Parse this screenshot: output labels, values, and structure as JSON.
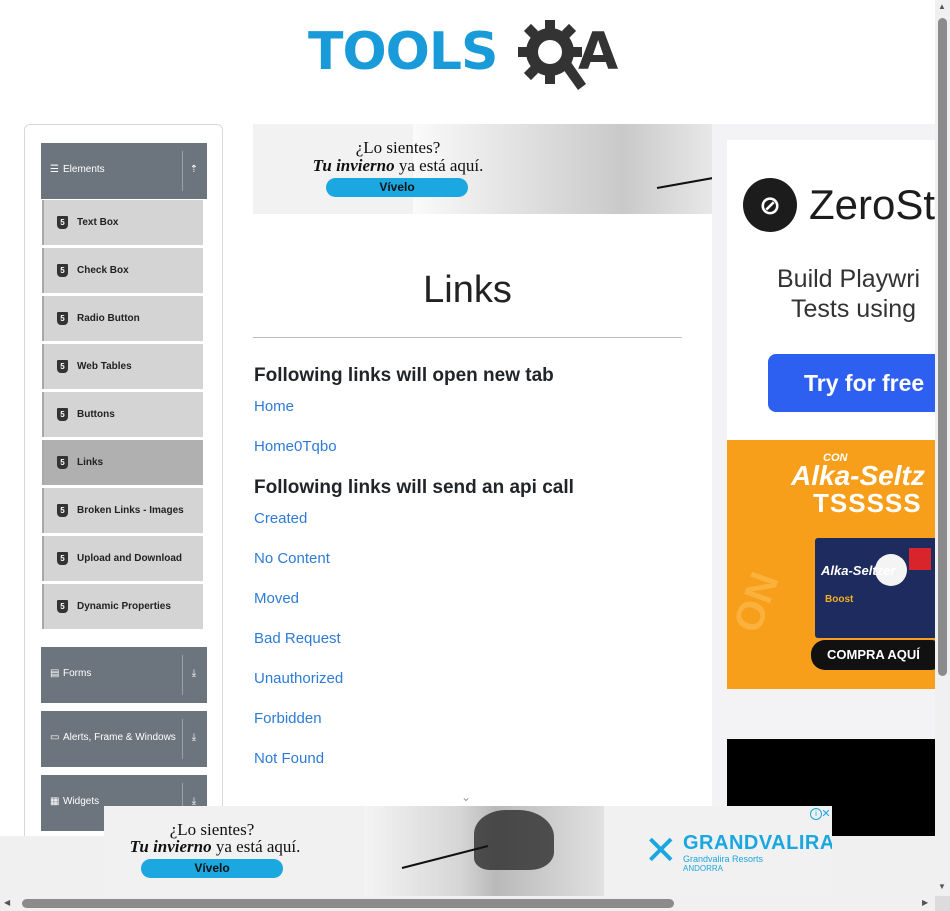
{
  "header": {
    "logo_tools": "TOOLS",
    "logo_q": "Q",
    "logo_a": "A"
  },
  "sidebar": {
    "groups": [
      {
        "label": "Elements",
        "icon": "hamburger-icon",
        "arrow": "up-arrow-icon"
      },
      {
        "label": "Forms",
        "icon": "doc-icon",
        "arrow": "down-arrow-icon"
      },
      {
        "label": "Alerts, Frame & Windows",
        "icon": "window-icon",
        "arrow": "down-arrow-icon"
      },
      {
        "label": "Widgets",
        "icon": "grid-icon",
        "arrow": "down-arrow-icon"
      }
    ],
    "items": [
      {
        "label": "Text Box"
      },
      {
        "label": "Check Box"
      },
      {
        "label": "Radio Button"
      },
      {
        "label": "Web Tables"
      },
      {
        "label": "Buttons"
      },
      {
        "label": "Links",
        "active": true
      },
      {
        "label": "Broken Links - Images"
      },
      {
        "label": "Upload and Download"
      },
      {
        "label": "Dynamic Properties"
      }
    ]
  },
  "ad_top": {
    "line1": "¿Lo sientes?",
    "line2_em": "Tu invierno",
    "line2_rest": " ya está aquí.",
    "button": "Vívelo"
  },
  "main": {
    "title": "Links",
    "section1": "Following links will open new tab",
    "links1": [
      "Home",
      "Home0Tqbo"
    ],
    "section2": "Following links will send an api call",
    "links2": [
      "Created",
      "No Content",
      "Moved",
      "Bad Request",
      "Unauthorized",
      "Forbidden",
      "Not Found"
    ]
  },
  "right_ad": {
    "brand": "ZeroSt",
    "tag1": "Build Playwri",
    "tag2": "Tests using",
    "cta": "Try for free",
    "alka_con": "CON",
    "alka_brand": "Alka-Seltz",
    "alka_tss": "TSSSSS",
    "alka_box_logo": "Alka-Seltzer",
    "alka_box_boost": "Boost",
    "alka_cta": "COMPRA AQUÍ",
    "alka_bg": "ON"
  },
  "ad_bottom": {
    "line1": "¿Lo sientes?",
    "line2_em": "Tu invierno",
    "line2_rest": " ya está aquí.",
    "button": "Vívelo",
    "gv_name": "GRANDVALIRA",
    "gv_sub": "Grandvalira Resorts",
    "gv_sub2": "ANDORRA"
  },
  "colors": {
    "link": "#2e7bd6",
    "sidebar_header": "#6c757d",
    "logo_blue": "#1a9bd9",
    "ad_blue": "#1ba7e0",
    "alka_orange": "#f79e1b",
    "zerostep_blue": "#2d5ff0"
  }
}
